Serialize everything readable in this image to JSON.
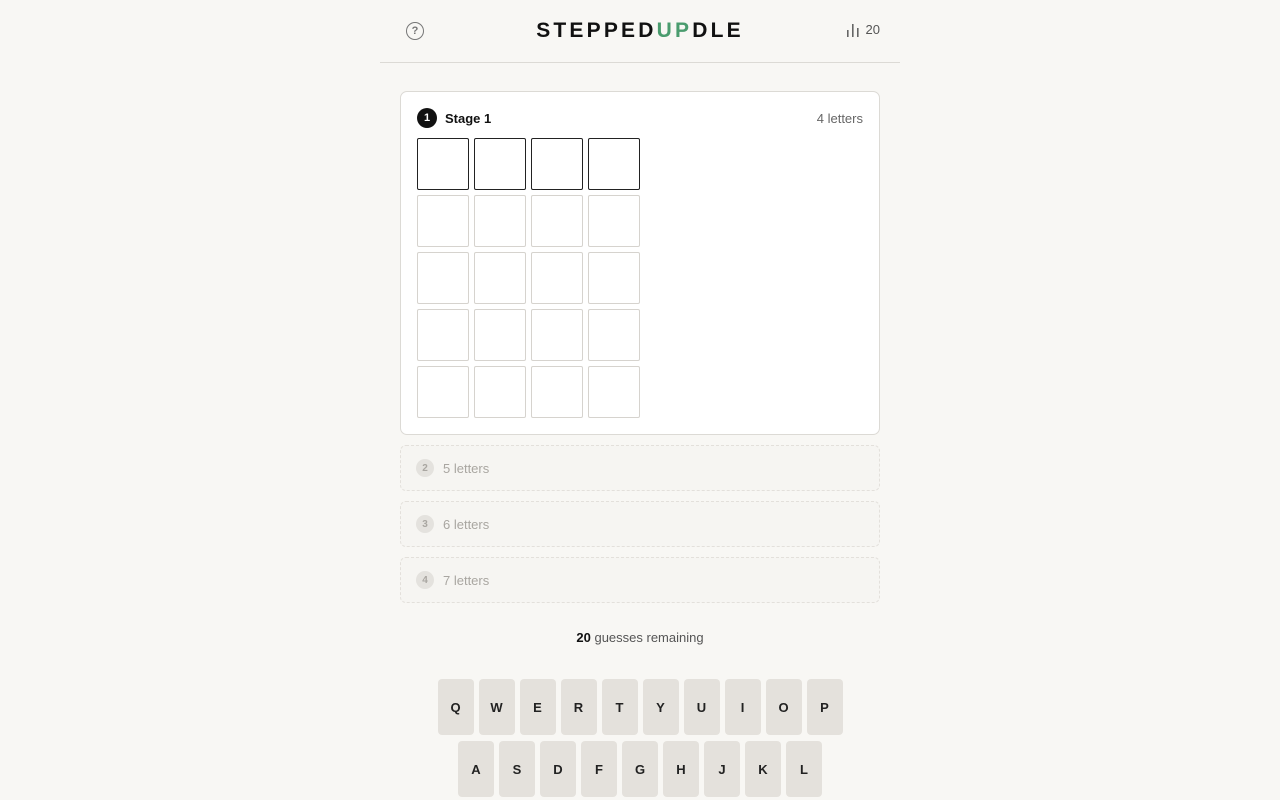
{
  "header": {
    "help_icon_glyph": "?",
    "logo_part1": "STEPPED",
    "logo_accent": "UP",
    "logo_part2": "DLE",
    "stats_count": "20"
  },
  "colors": {
    "accent": "#4a9c6e",
    "background": "#f8f7f4"
  },
  "active_stage": {
    "number": "1",
    "title": "Stage 1",
    "letters_label": "4 letters",
    "word_length": 4,
    "rows": 5
  },
  "locked_stages": [
    {
      "number": "2",
      "label": "5 letters"
    },
    {
      "number": "3",
      "label": "6 letters"
    },
    {
      "number": "4",
      "label": "7 letters"
    }
  ],
  "status": {
    "guesses_count": "20",
    "guesses_suffix": " guesses remaining"
  },
  "keyboard": {
    "row1": [
      "Q",
      "W",
      "E",
      "R",
      "T",
      "Y",
      "U",
      "I",
      "O",
      "P"
    ],
    "row2": [
      "A",
      "S",
      "D",
      "F",
      "G",
      "H",
      "J",
      "K",
      "L"
    ]
  }
}
